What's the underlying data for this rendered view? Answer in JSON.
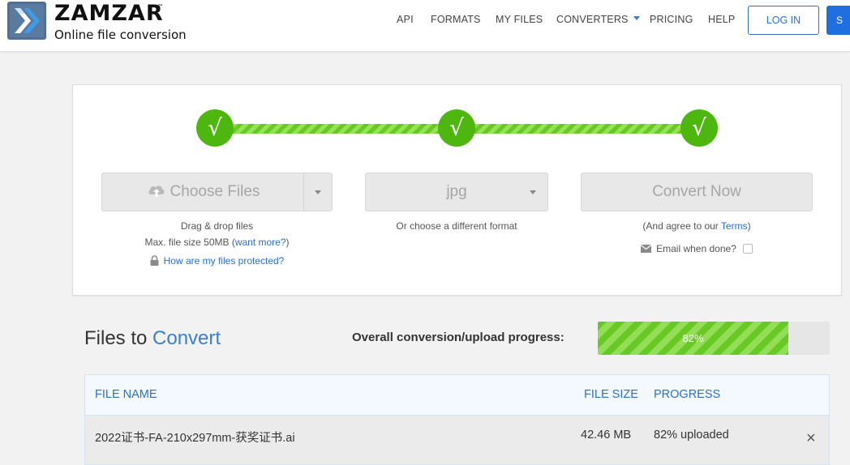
{
  "brand": {
    "name": "ZAMZAR",
    "trademark": "™",
    "tagline": "Online file conversion"
  },
  "nav": {
    "api": "API",
    "formats": "FORMATS",
    "my_files": "MY FILES",
    "converters": "CONVERTERS",
    "pricing": "PRICING",
    "help": "HELP",
    "login": "LOG IN",
    "signup": "S"
  },
  "steps": {
    "check_glyph": "√",
    "choose_files_label": "Choose Files",
    "drag_drop": "Drag & drop files",
    "max_size_prefix": "Max. file size 50MB (",
    "want_more": "want more?",
    "max_size_suffix": ")",
    "protected_link": "How are my files protected?",
    "format_value": "jpg",
    "different_format": "Or choose a different format",
    "convert_label": "Convert Now",
    "agree_prefix": "(And agree to our ",
    "terms": "Terms",
    "agree_suffix": ")",
    "email_label": "Email when done?"
  },
  "files": {
    "title_part1": "Files to ",
    "title_part2": "Convert",
    "overall_label": "Overall conversion/upload progress:",
    "progress_text": "82%",
    "progress_value": 82,
    "columns": {
      "file_name": "FILE NAME",
      "file_size": "FILE SIZE",
      "progress": "PROGRESS"
    },
    "rows": [
      {
        "file_name": "2022证书-FA-210x297mm-获奖证书.ai",
        "file_size": "42.46 MB",
        "progress": "82% uploaded",
        "remove": "×"
      }
    ]
  },
  "colors": {
    "accent_blue": "#2c6fd0",
    "progress_green": "#69c924",
    "step_green": "#4db60f"
  }
}
